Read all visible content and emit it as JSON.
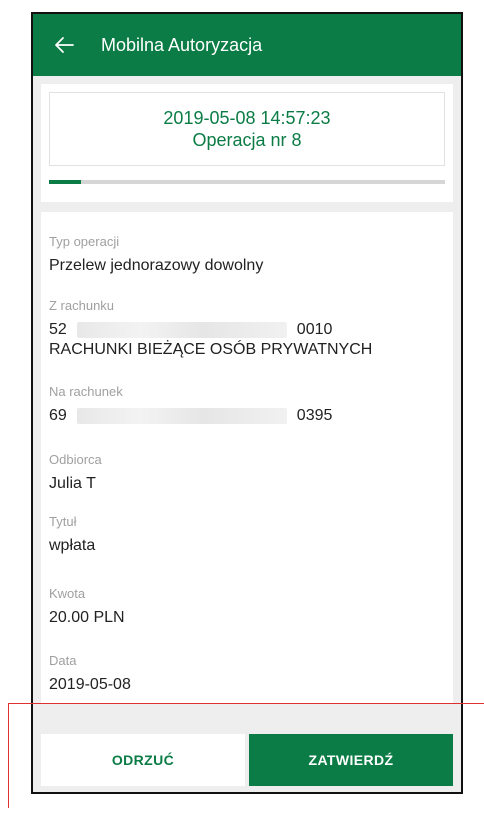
{
  "header": {
    "title": "Mobilna Autoryzacja",
    "back_icon": "arrow-left-icon"
  },
  "operation": {
    "datetime": "2019-05-08 14:57:23",
    "number_label": "Operacja nr 8",
    "progress": 0.08
  },
  "fields": {
    "type": {
      "label": "Typ operacji",
      "value": "Przelew jednorazowy dowolny"
    },
    "from": {
      "label": "Z rachunku",
      "prefix": "52",
      "suffix": "0010",
      "name": "RACHUNKI BIEŻĄCE OSÓB PRYWATNYCH"
    },
    "to": {
      "label": "Na rachunek",
      "prefix": "69",
      "suffix": "0395"
    },
    "recipient": {
      "label": "Odbiorca",
      "value": "Julia T"
    },
    "title": {
      "label": "Tytuł",
      "value": "wpłata"
    },
    "amount": {
      "label": "Kwota",
      "value": "20.00 PLN"
    },
    "date": {
      "label": "Data",
      "value": "2019-05-08"
    }
  },
  "actions": {
    "reject_label": "ODRZUĆ",
    "confirm_label": "ZATWIERDŹ"
  },
  "colors": {
    "primary": "#0b7c45",
    "background": "#eeeeee",
    "annotation": "#e03030"
  }
}
